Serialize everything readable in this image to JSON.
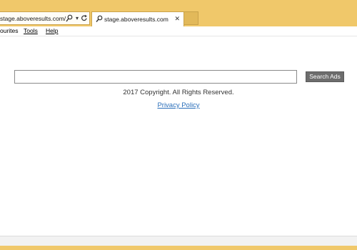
{
  "browser": {
    "address_url": "stage.aboveresults.com/",
    "tab_title": "stage.aboveresults.com",
    "icons": {
      "search": "search-icon",
      "refresh": "refresh-icon",
      "favicon": "search-favicon-icon",
      "close": "close-icon"
    },
    "colors": {
      "chrome": "#f0c86a",
      "border": "#c9a24a"
    }
  },
  "menubar": {
    "items": [
      {
        "label": "ourites"
      },
      {
        "label": "Tools"
      },
      {
        "label": "Help"
      }
    ]
  },
  "search": {
    "value": "",
    "button_label": "Search Ads"
  },
  "footer": {
    "copyright": "2017 Copyright. All Rights Reserved.",
    "privacy_label": "Privacy Policy",
    "link_color": "#2a6fba"
  }
}
